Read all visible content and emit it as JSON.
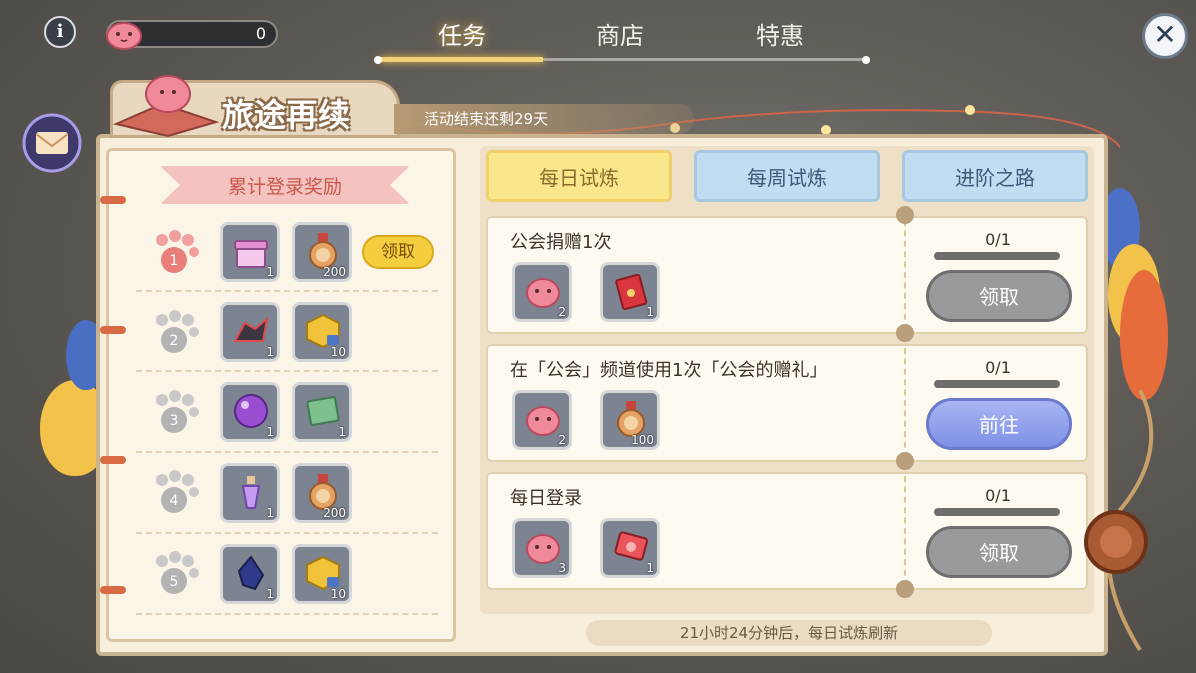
{
  "top": {
    "currency_value": "0",
    "tabs": [
      {
        "label": "任务",
        "active": true
      },
      {
        "label": "商店",
        "active": false
      },
      {
        "label": "特惠",
        "active": false
      }
    ],
    "info_glyph": "i",
    "close_glyph": "✕"
  },
  "event": {
    "title": "旅途再续",
    "timer": "活动结束还剩29天"
  },
  "login_rewards": {
    "header": "累计登录奖励",
    "claim_label": "领取",
    "rows": [
      {
        "day": "1",
        "items": [
          {
            "icon": "gift-chest-icon",
            "count": "1"
          },
          {
            "icon": "medal-icon",
            "count": "200"
          }
        ],
        "claimable": true
      },
      {
        "day": "2",
        "items": [
          {
            "icon": "dragon-mount-icon",
            "count": "1"
          },
          {
            "icon": "locked-gold-cube-icon",
            "count": "10"
          }
        ],
        "claimable": false
      },
      {
        "day": "3",
        "items": [
          {
            "icon": "purple-orb-icon",
            "count": "1"
          },
          {
            "icon": "green-book-icon",
            "count": "1"
          }
        ],
        "claimable": false
      },
      {
        "day": "4",
        "items": [
          {
            "icon": "potion-bottle-icon",
            "count": "1"
          },
          {
            "icon": "medal-icon",
            "count": "200"
          }
        ],
        "claimable": false
      },
      {
        "day": "5",
        "items": [
          {
            "icon": "dark-crystal-icon",
            "count": "1"
          },
          {
            "icon": "locked-gold-cube-icon",
            "count": "10"
          }
        ],
        "claimable": false
      }
    ]
  },
  "subtabs": [
    {
      "label": "每日试炼",
      "active": true
    },
    {
      "label": "每周试炼",
      "active": false
    },
    {
      "label": "进阶之路",
      "active": false
    }
  ],
  "tasks": [
    {
      "title": "公会捐赠1次",
      "progress": "0/1",
      "button": "领取",
      "button_style": "gray",
      "items": [
        {
          "icon": "pink-poring-icon",
          "count": "2"
        },
        {
          "icon": "red-envelope-icon",
          "count": "1"
        }
      ]
    },
    {
      "title": "在「公会」频道使用1次「公会的赠礼」",
      "progress": "0/1",
      "button": "前往",
      "button_style": "blue",
      "items": [
        {
          "icon": "pink-poring-icon",
          "count": "2"
        },
        {
          "icon": "medal-icon",
          "count": "100"
        }
      ]
    },
    {
      "title": "每日登录",
      "progress": "0/1",
      "button": "领取",
      "button_style": "gray",
      "items": [
        {
          "icon": "pink-poring-icon",
          "count": "3"
        },
        {
          "icon": "red-card-icon",
          "count": "1"
        }
      ]
    }
  ],
  "refresh_text": "21小时24分钟后，每日试炼刷新",
  "colors": {
    "accent_gold": "#f5ce3f",
    "active_tab": "#fbe78b",
    "inactive_tab": "#c1ddf2",
    "go_button": "#8d9ee9",
    "disabled_button": "#9a9a9c"
  }
}
